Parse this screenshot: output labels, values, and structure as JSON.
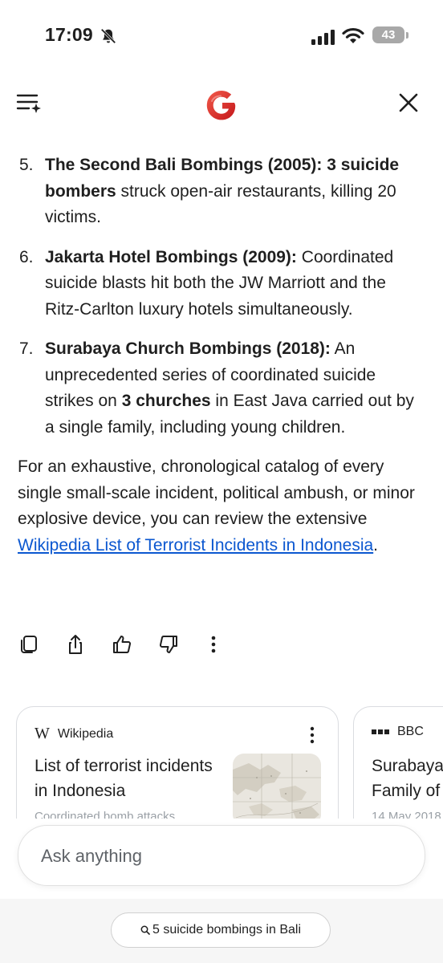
{
  "status_bar": {
    "time": "17:09",
    "battery": "43"
  },
  "header": {
    "logo_alt": "G",
    "menu_icon": "menu-sparkle-icon",
    "close_icon": "close-icon"
  },
  "list": [
    {
      "num": "5.",
      "bold": "The Second Bali Bombings (2005): 3 suicide bombers",
      "text": " struck open-air restaurants, killing 20 victims."
    },
    {
      "num": "6.",
      "bold": "Jakarta Hotel Bombings (2009):",
      "text": " Coordinated suicide blasts hit both the JW Marriott and the Ritz-Carlton luxury hotels simultaneously."
    },
    {
      "num": "7.",
      "bold": "Surabaya Church Bombings (2018):",
      "text_a": " An unprecedented series of coordinated suicide strikes on ",
      "bold2": "3 churches",
      "text_b": " in East Java carried out by a single family, including young children."
    }
  ],
  "summary": {
    "text": "For an exhaustive, chronological catalog of every single small-scale incident, political ambush, or minor explosive device, you can review the extensive ",
    "link": "Wikipedia List of Terrorist Incidents in Indonesia",
    "end": "."
  },
  "actions": [
    "copy-icon",
    "share-icon",
    "thumbs-up-icon",
    "thumbs-down-icon",
    "more-vertical-icon"
  ],
  "cards": [
    {
      "source": "Wikipedia",
      "title": "List of terrorist incidents in Indonesia",
      "sub": "Coordinated bomb attacks"
    },
    {
      "source": "BBC",
      "title": "Surabaya Family of",
      "sub": "14 May 2018"
    }
  ],
  "ask": {
    "placeholder": "Ask anything"
  },
  "query_chip": {
    "label": "5 suicide bombings in Bali"
  }
}
